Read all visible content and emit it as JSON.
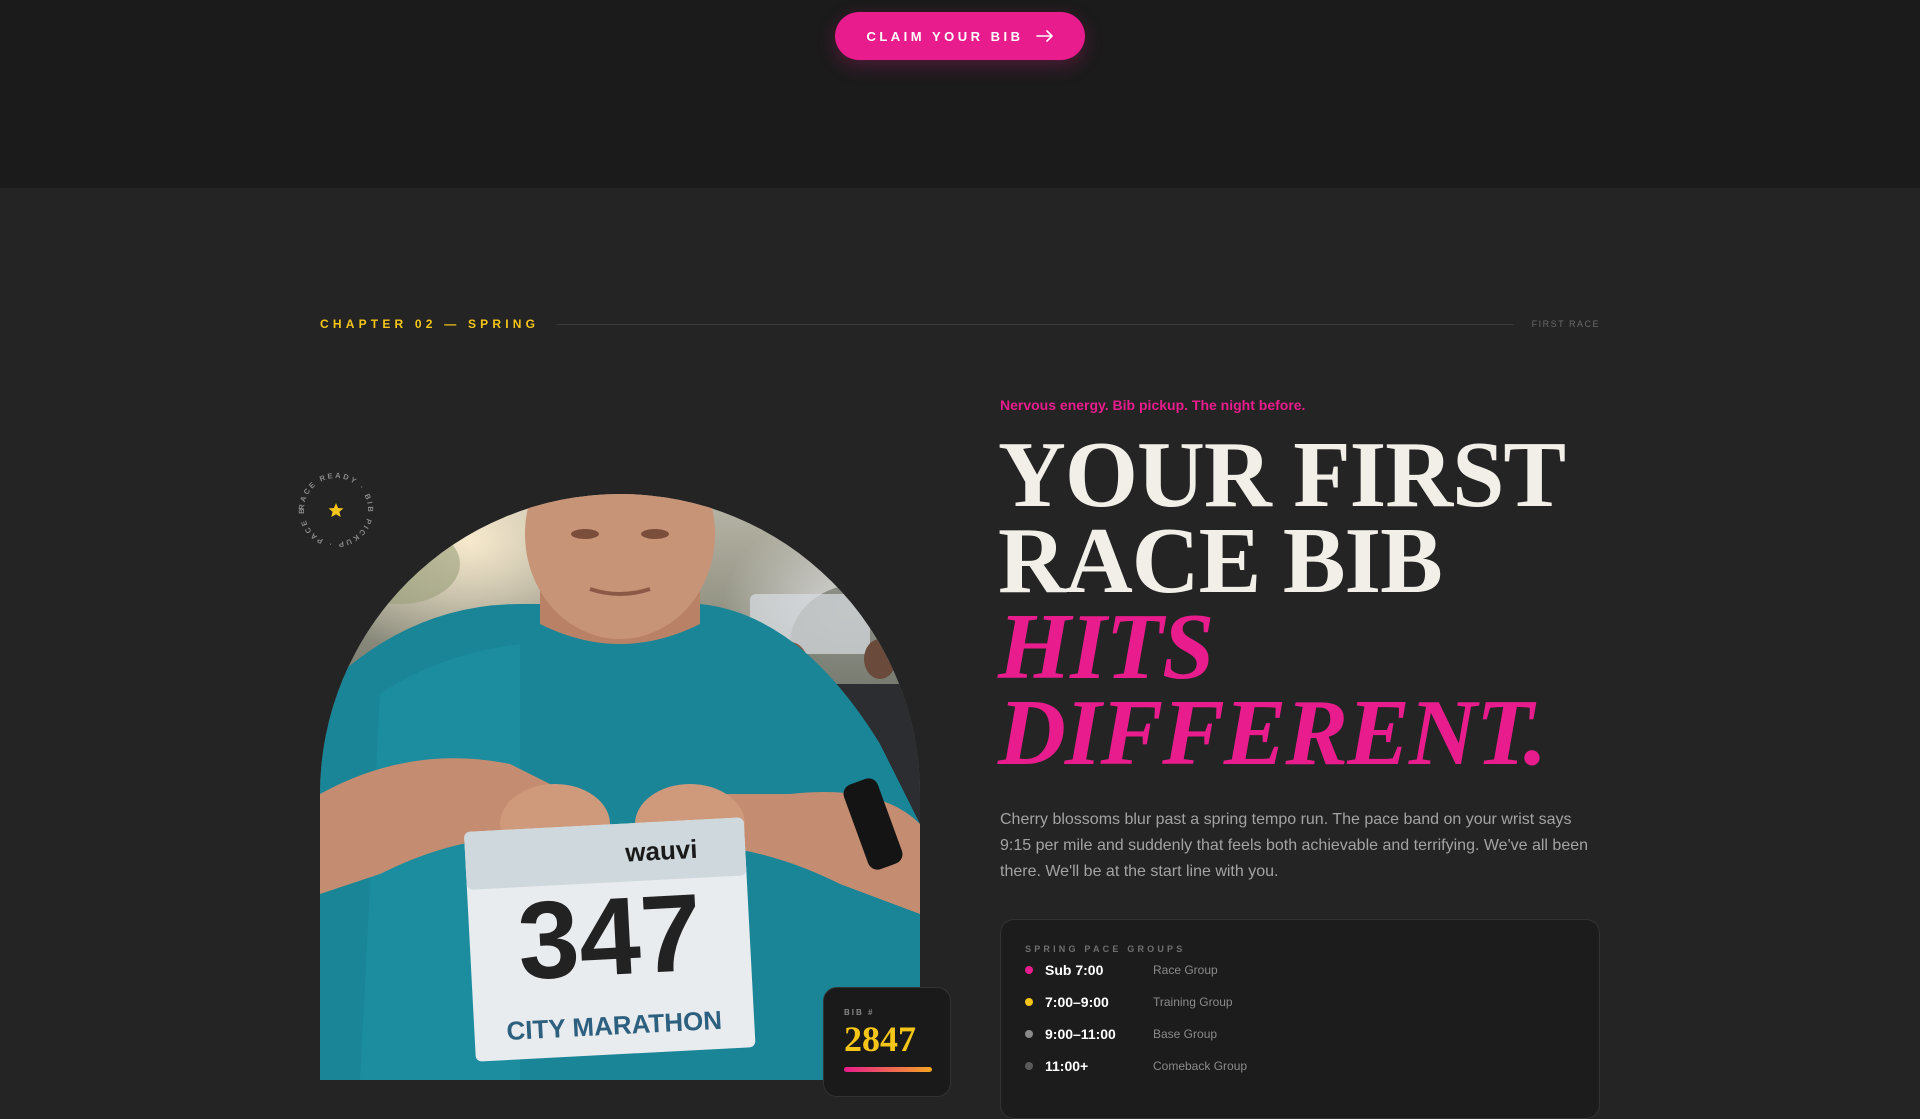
{
  "cta": {
    "label": "CLAIM YOUR BIB",
    "color": "#e81c8c"
  },
  "chapter": {
    "label": "CHAPTER 02 — SPRING",
    "right_label": "FIRST RACE"
  },
  "badge": {
    "ring_text": "RACE READY · BIB PICKUP · PACE BAND · ",
    "icon": "star-icon"
  },
  "photo": {
    "bib_text": "347",
    "bib_event": "CITY MARATHON",
    "bib_sponsor": "wauvi"
  },
  "bib_card": {
    "label": "BIB #",
    "number": "2847"
  },
  "hero": {
    "kicker": "Nervous energy. Bib pickup. The night before.",
    "headline_1": "YOUR FIRST",
    "headline_2": "RACE BIB",
    "headline_3": "HITS",
    "headline_4": "DIFFERENT.",
    "body": "Cherry blossoms blur past a spring tempo run. The pace band on your wrist says 9:15 per mile and suddenly that feels both achievable and terrifying. We've all been there. We'll be at the start line with you."
  },
  "pace_groups": {
    "title": "SPRING PACE GROUPS",
    "rows": [
      {
        "time": "Sub 7:00",
        "group": "Race Group",
        "color": "#e81c8c"
      },
      {
        "time": "7:00–9:00",
        "group": "Training Group",
        "color": "#f5c518"
      },
      {
        "time": "9:00–11:00",
        "group": "Base Group",
        "color": "#8a8a8a"
      },
      {
        "time": "11:00+",
        "group": "Comeback Group",
        "color": "#5a5a5a"
      }
    ]
  },
  "colors": {
    "accent": "#e81c8c",
    "gold": "#f5c518",
    "bg": "#242424"
  }
}
